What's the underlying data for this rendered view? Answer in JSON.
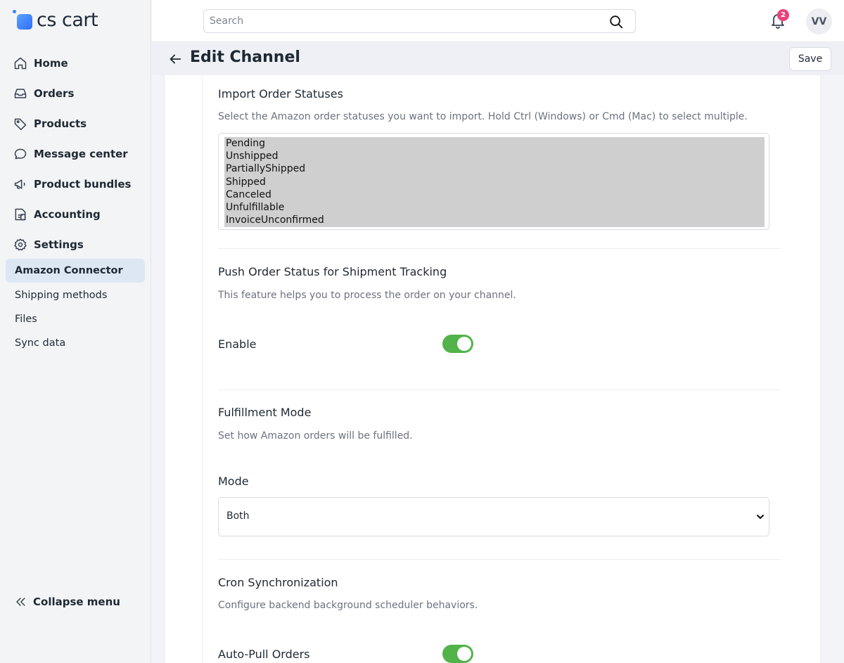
{
  "brand": {
    "name": "cs cart"
  },
  "sidebar": {
    "items": [
      {
        "label": "Home",
        "icon": "home-icon"
      },
      {
        "label": "Orders",
        "icon": "inbox-icon"
      },
      {
        "label": "Products",
        "icon": "tag-icon"
      },
      {
        "label": "Message center",
        "icon": "chat-icon"
      },
      {
        "label": "Product bundles",
        "icon": "megaphone-icon"
      },
      {
        "label": "Accounting",
        "icon": "document-icon"
      },
      {
        "label": "Settings",
        "icon": "gear-icon"
      }
    ],
    "subitems": [
      {
        "label": "Amazon Connector",
        "active": true
      },
      {
        "label": "Shipping methods",
        "active": false
      },
      {
        "label": "Files",
        "active": false
      },
      {
        "label": "Sync data",
        "active": false
      }
    ],
    "collapse_label": "Collapse menu"
  },
  "topbar": {
    "search_placeholder": "Search",
    "notification_count": "2",
    "avatar_initials": "VV"
  },
  "page": {
    "title": "Edit Channel",
    "save_label": "Save"
  },
  "sections": {
    "import": {
      "title": "Import Order Statuses",
      "desc": "Select the Amazon order statuses you want to import. Hold Ctrl (Windows) or Cmd (Mac) to select multiple.",
      "options": [
        "Pending",
        "Unshipped",
        "PartiallyShipped",
        "Shipped",
        "Canceled",
        "Unfulfillable",
        "InvoiceUnconfirmed"
      ]
    },
    "push": {
      "title": "Push Order Status for Shipment Tracking",
      "desc": "This feature helps you to process the order on your channel.",
      "enable_label": "Enable",
      "enabled": true
    },
    "fulfillment": {
      "title": "Fulfillment Mode",
      "desc": "Set how Amazon orders will be fulfilled.",
      "mode_label": "Mode",
      "mode_value": "Both"
    },
    "cron": {
      "title": "Cron Synchronization",
      "desc": "Configure backend background scheduler behaviors.",
      "autopull_label": "Auto-Pull Orders",
      "autopull_enabled": true
    }
  },
  "colors": {
    "accent": "#3b82f6",
    "toggle_on": "#52b34a",
    "badge": "#e8437b",
    "active_nav": "#dde7f4"
  }
}
